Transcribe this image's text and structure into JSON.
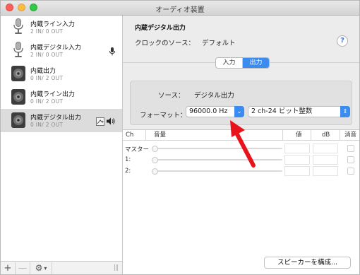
{
  "window": {
    "title": "オーディオ装置"
  },
  "sidebar": {
    "devices": [
      {
        "name": "内蔵ライン入力",
        "io": "2 IN/ 0 OUT",
        "type": "mic",
        "selected": false
      },
      {
        "name": "内蔵デジタル入力",
        "io": "2 IN/ 0 OUT",
        "type": "mic",
        "selected": false,
        "badge": "mic-badge-icon"
      },
      {
        "name": "内蔵出力",
        "io": "0 IN/ 2 OUT",
        "type": "speaker",
        "selected": false
      },
      {
        "name": "内蔵ライン出力",
        "io": "0 IN/ 2 OUT",
        "type": "speaker",
        "selected": false
      },
      {
        "name": "内蔵デジタル出力",
        "io": "0 IN/ 2 OUT",
        "type": "speaker",
        "selected": true
      }
    ],
    "bottom": {
      "add": "+",
      "remove": "—",
      "gear": "⚙",
      "gear_caret": "▾",
      "grip": "|||"
    }
  },
  "detail": {
    "device_title": "内蔵デジタル出力",
    "clock_label": "クロックのソース：",
    "clock_value": "デフォルト",
    "help": "?",
    "tabs": {
      "input": "入力",
      "output": "出力",
      "active": "output"
    },
    "source_label": "ソース：",
    "source_value": "デジタル出力",
    "format_label": "フォーマット：",
    "sample_rate": "96000.0 Hz",
    "bit_format": "2 ch-24 ビット整数",
    "popup_arrow_single": "⌄",
    "popup_arrow_double": "⇕"
  },
  "mixer": {
    "headers": {
      "ch": "Ch",
      "volume": "音量",
      "value": "値",
      "db": "dB",
      "mute": "消音"
    },
    "rows": [
      {
        "label": "マスター",
        "volume": 0
      },
      {
        "label": "1:",
        "volume": 0
      },
      {
        "label": "2:",
        "volume": 0
      }
    ]
  },
  "configure_speakers": "スピーカーを構成...",
  "colors": {
    "accent": "#3b8cf0",
    "annotation_arrow": "#e8141b"
  }
}
